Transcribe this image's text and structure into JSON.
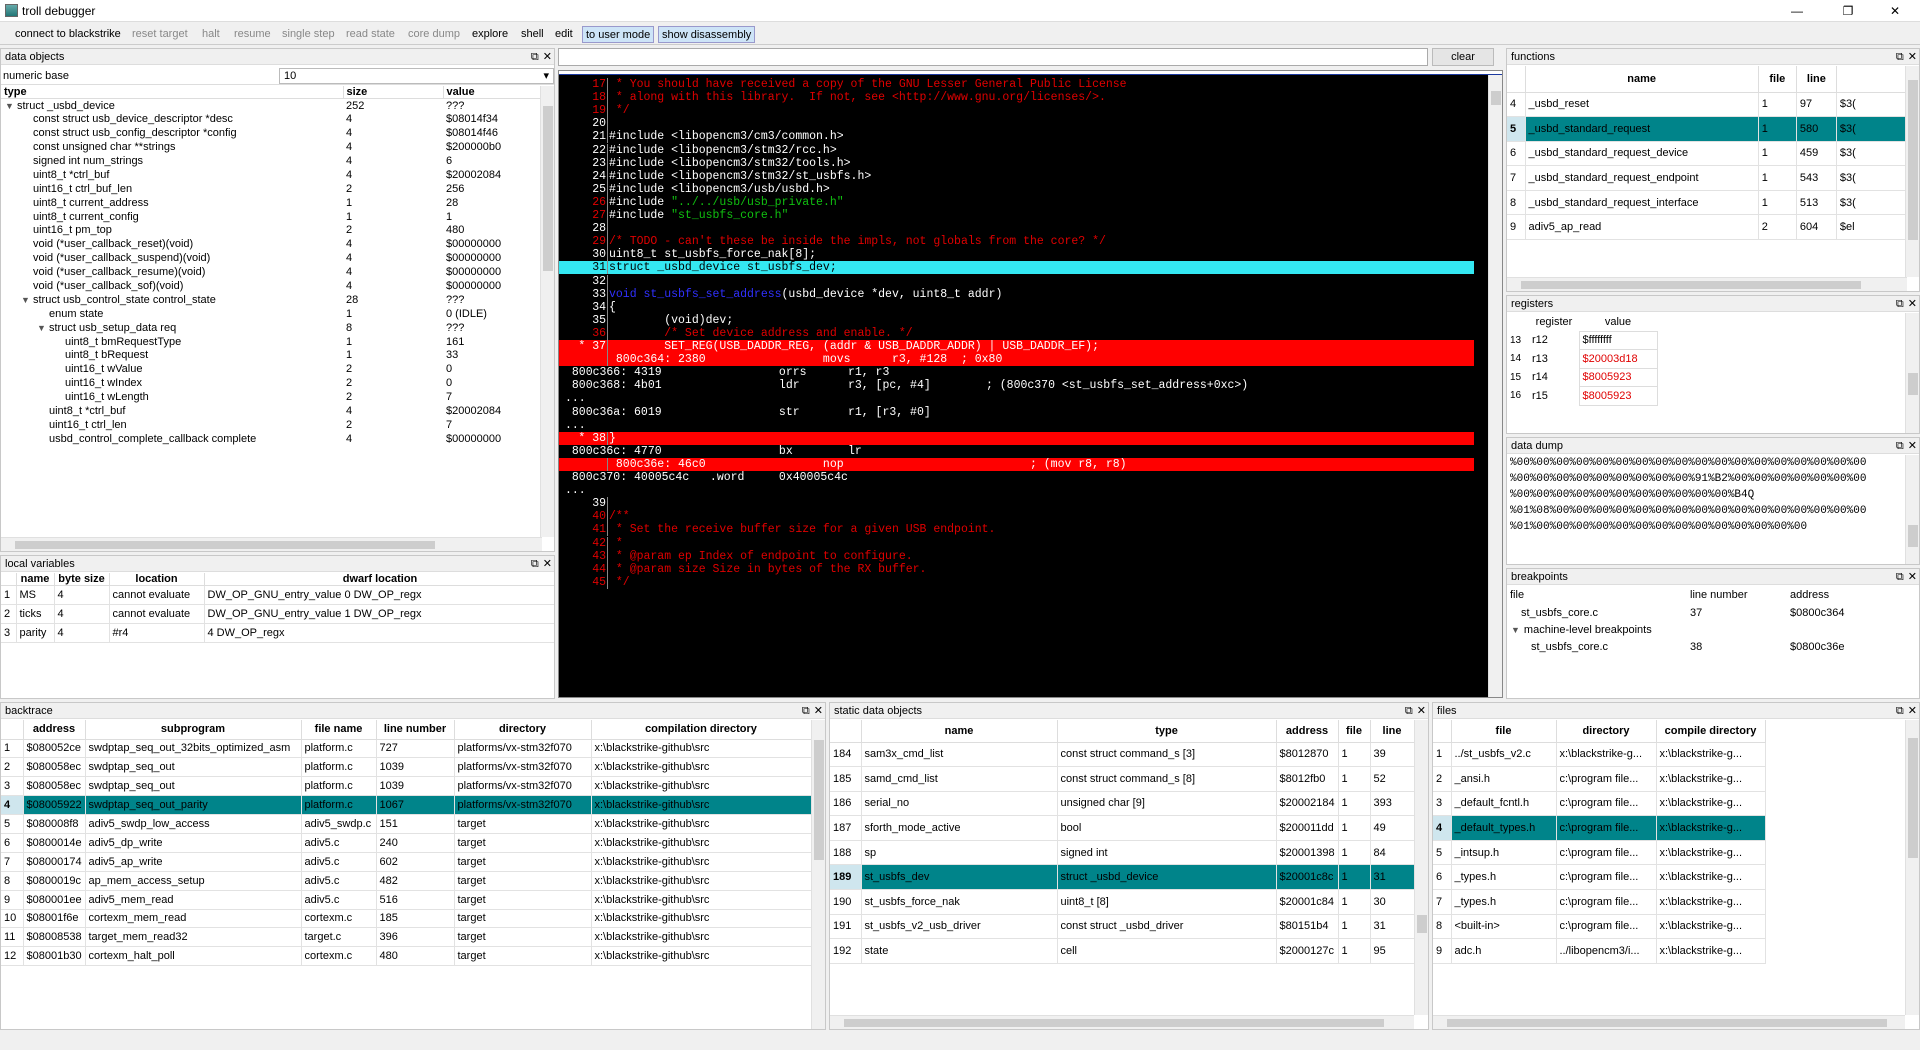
{
  "window": {
    "title": "troll debugger",
    "min": "—",
    "max": "❐",
    "close": "✕"
  },
  "toolbar": [
    "connect to blackstrike",
    "reset target",
    "halt",
    "resume",
    "single step",
    "read state",
    "core dump",
    "explore",
    "shell",
    "edit",
    "to user mode",
    "show disassembly"
  ],
  "data_objects": {
    "title": "data objects",
    "numeric_base_label": "numeric base",
    "numeric_base": "10",
    "cols": [
      "type",
      "size",
      "value"
    ],
    "rows": [
      {
        "i": 0,
        "e": "▼",
        "t": "struct _usbd_device",
        "s": "252",
        "v": "???"
      },
      {
        "i": 1,
        "t": "const struct usb_device_descriptor *desc",
        "s": "4",
        "v": "$08014f34"
      },
      {
        "i": 1,
        "t": "const struct usb_config_descriptor *config",
        "s": "4",
        "v": "$08014f46"
      },
      {
        "i": 1,
        "t": "const unsigned char **strings",
        "s": "4",
        "v": "$200000b0"
      },
      {
        "i": 1,
        "t": "signed int num_strings",
        "s": "4",
        "v": "6"
      },
      {
        "i": 1,
        "t": "uint8_t *ctrl_buf",
        "s": "4",
        "v": "$20002084"
      },
      {
        "i": 1,
        "t": "uint16_t ctrl_buf_len",
        "s": "2",
        "v": "256"
      },
      {
        "i": 1,
        "t": "uint8_t current_address",
        "s": "1",
        "v": "28"
      },
      {
        "i": 1,
        "t": "uint8_t current_config",
        "s": "1",
        "v": "1"
      },
      {
        "i": 1,
        "t": "uint16_t pm_top",
        "s": "2",
        "v": "480"
      },
      {
        "i": 1,
        "t": "void (*user_callback_reset)(void)",
        "s": "4",
        "v": "$00000000"
      },
      {
        "i": 1,
        "t": "void (*user_callback_suspend)(void)",
        "s": "4",
        "v": "$00000000"
      },
      {
        "i": 1,
        "t": "void (*user_callback_resume)(void)",
        "s": "4",
        "v": "$00000000"
      },
      {
        "i": 1,
        "t": "void (*user_callback_sof)(void)",
        "s": "4",
        "v": "$00000000"
      },
      {
        "i": 1,
        "e": "▼",
        "t": "struct usb_control_state control_state",
        "s": "28",
        "v": "???"
      },
      {
        "i": 2,
        "t": "enum  state",
        "s": "1",
        "v": "0 (IDLE)"
      },
      {
        "i": 2,
        "e": "▼",
        "t": "struct usb_setup_data req",
        "s": "8",
        "v": "???"
      },
      {
        "i": 3,
        "t": "uint8_t bmRequestType",
        "s": "1",
        "v": "161"
      },
      {
        "i": 3,
        "t": "uint8_t bRequest",
        "s": "1",
        "v": "33"
      },
      {
        "i": 3,
        "t": "uint16_t wValue",
        "s": "2",
        "v": "0"
      },
      {
        "i": 3,
        "t": "uint16_t wIndex",
        "s": "2",
        "v": "0"
      },
      {
        "i": 3,
        "t": "uint16_t wLength",
        "s": "2",
        "v": "7"
      },
      {
        "i": 2,
        "t": "uint8_t *ctrl_buf",
        "s": "4",
        "v": "$20002084"
      },
      {
        "i": 2,
        "t": "uint16_t ctrl_len",
        "s": "2",
        "v": "7"
      },
      {
        "i": 2,
        "t": "usbd_control_complete_callback complete",
        "s": "4",
        "v": "$00000000"
      }
    ]
  },
  "local_vars": {
    "title": "local variables",
    "cols": [
      "name",
      "byte size",
      "location",
      "dwarf location"
    ],
    "rows": [
      [
        "1",
        "MS",
        "4",
        "cannot evaluate",
        "DW_OP_GNU_entry_value 0 DW_OP_regx",
        "DW_OP_GNU_entry_value"
      ],
      [
        "2",
        "ticks",
        "4",
        "cannot evaluate",
        "DW_OP_GNU_entry_value 1 DW_OP_regx",
        "DW_OP_GNU_entry_value"
      ],
      [
        "3",
        "parity",
        "4",
        "#r4",
        "4 DW_OP_regx",
        ""
      ]
    ]
  },
  "search": {
    "value": "",
    "clear": "clear"
  },
  "source": [
    {
      "n": "17",
      "t": " * You should have received a copy of the GNU Lesser General Public License",
      "c": "red"
    },
    {
      "n": "18",
      "t": " * along with this library.  If not, see <http://www.gnu.org/licenses/>.",
      "c": "red"
    },
    {
      "n": "19",
      "t": " */",
      "c": "red"
    },
    {
      "n": "20",
      "t": "",
      "c": ""
    },
    {
      "n": "21",
      "t": "#include <libopencm3/cm3/common.h>",
      "c": ""
    },
    {
      "n": "22",
      "t": "#include <libopencm3/stm32/rcc.h>",
      "c": ""
    },
    {
      "n": "23",
      "t": "#include <libopencm3/stm32/tools.h>",
      "c": ""
    },
    {
      "n": "24",
      "t": "#include <libopencm3/stm32/st_usbfs.h>",
      "c": ""
    },
    {
      "n": "25",
      "t": "#include <libopencm3/usb/usbd.h>",
      "c": ""
    },
    {
      "n": "26",
      "t": "#include \"../../usb/usb_private.h\"",
      "c": "grn"
    },
    {
      "n": "27",
      "t": "#include \"st_usbfs_core.h\"",
      "c": "grn"
    },
    {
      "n": "28",
      "t": "",
      "c": ""
    },
    {
      "n": "29",
      "t": "/* TODO - can't these be inside the impls, not globals from the core? */",
      "c": "red"
    },
    {
      "n": "30",
      "t": "uint8_t st_usbfs_force_nak[8];",
      "c": ""
    },
    {
      "n": "31",
      "t": "struct _usbd_device st_usbfs_dev;",
      "c": "cur"
    },
    {
      "n": "32",
      "t": "",
      "c": ""
    },
    {
      "n": "33",
      "t": "void st_usbfs_set_address(usbd_device *dev, uint8_t addr)",
      "c": "fn"
    },
    {
      "n": "34",
      "t": "{",
      "c": ""
    },
    {
      "n": "35",
      "t": "        (void)dev;",
      "c": ""
    },
    {
      "n": "36",
      "t": "        /* Set device address and enable. */",
      "c": "red"
    },
    {
      "n": "* 37",
      "t": "        SET_REG(USB_DADDR_REG, (addr & USB_DADDR_ADDR) | USB_DADDR_EF);",
      "c": "brk"
    },
    {
      "n": "",
      "t": " 800c364: 2380                 movs      r3, #128  ; 0x80",
      "c": "brk"
    },
    {
      "n": "",
      "t": " 800c366: 4319                 orrs      r1, r3",
      "c": "asm"
    },
    {
      "n": "",
      "t": " 800c368: 4b01                 ldr       r3, [pc, #4]        ; (800c370 <st_usbfs_set_address+0xc>)",
      "c": "asm"
    },
    {
      "n": "",
      "t": "...",
      "c": "asm"
    },
    {
      "n": "",
      "t": " 800c36a: 6019                 str       r1, [r3, #0]",
      "c": "asm"
    },
    {
      "n": "",
      "t": "...",
      "c": "asm"
    },
    {
      "n": "* 38",
      "t": "}",
      "c": "brk"
    },
    {
      "n": "",
      "t": " 800c36c: 4770                 bx        lr",
      "c": "asm"
    },
    {
      "n": "",
      "t": " 800c36e: 46c0                 nop                           ; (mov r8, r8)",
      "c": "brk"
    },
    {
      "n": "",
      "t": " 800c370: 40005c4c   .word     0x40005c4c",
      "c": "asm"
    },
    {
      "n": "",
      "t": "...",
      "c": "asm"
    },
    {
      "n": "39",
      "t": "",
      "c": ""
    },
    {
      "n": "40",
      "t": "/**",
      "c": "red"
    },
    {
      "n": "41",
      "t": " * Set the receive buffer size for a given USB endpoint.",
      "c": "red"
    },
    {
      "n": "42",
      "t": " *",
      "c": "red"
    },
    {
      "n": "43",
      "t": " * @param ep Index of endpoint to configure.",
      "c": "red"
    },
    {
      "n": "44",
      "t": " * @param size Size in bytes of the RX buffer.",
      "c": "red"
    },
    {
      "n": "45",
      "t": " */",
      "c": "red"
    }
  ],
  "functions": {
    "title": "functions",
    "cols": [
      "name",
      "file",
      "line"
    ],
    "rows": [
      [
        "4",
        "_usbd_reset",
        "1",
        "97",
        "$3("
      ],
      [
        "5",
        "_usbd_standard_request",
        "1",
        "580",
        "$3("
      ],
      [
        "6",
        "_usbd_standard_request_device",
        "1",
        "459",
        "$3("
      ],
      [
        "7",
        "_usbd_standard_request_endpoint",
        "1",
        "543",
        "$3("
      ],
      [
        "8",
        "_usbd_standard_request_interface",
        "1",
        "513",
        "$3("
      ],
      [
        "9",
        "adiv5_ap_read",
        "2",
        "604",
        "$el"
      ]
    ],
    "sel": 1
  },
  "registers": {
    "title": "registers",
    "cols": [
      "register",
      "value"
    ],
    "rows": [
      [
        "13",
        "r12",
        "$ffffffff",
        false
      ],
      [
        "14",
        "r13",
        "$20003d18",
        true
      ],
      [
        "15",
        "r14",
        "$8005923",
        true
      ],
      [
        "16",
        "r15",
        "$8005923",
        true
      ]
    ]
  },
  "data_dump": {
    "title": "data dump",
    "lines": [
      "%00%00%00%00%00%00%00%00%00%00%00%00%00%00%00%00%00%00",
      "%00%00%00%00%00%00%00%00%00%91%B2%00%00%00%00%00%00%00",
      "%00%00%00%00%00%00%00%00%00%00%00%B4Q",
      "%01%08%00%00%00%00%00%00%00%00%00%00%00%00%00%00%00%00",
      "%01%00%00%00%00%00%00%00%00%00%00%00%00%00%00"
    ]
  },
  "breakpoints": {
    "title": "breakpoints",
    "cols": [
      "file",
      "line number",
      "address"
    ],
    "rows": [
      {
        "i": 1,
        "f": "st_usbfs_core.c",
        "l": "37",
        "a": "$0800c364"
      },
      {
        "i": 0,
        "e": "▼",
        "f": "machine-level breakpoints",
        "l": "",
        "a": ""
      },
      {
        "i": 2,
        "f": "st_usbfs_core.c",
        "l": "38",
        "a": "$0800c36e"
      }
    ]
  },
  "backtrace": {
    "title": "backtrace",
    "cols": [
      "address",
      "subprogram",
      "file name",
      "line number",
      "directory",
      "compilation directory"
    ],
    "rows": [
      [
        "1",
        "$080052ce",
        "swdptap_seq_out_32bits_optimized_asm",
        "platform.c",
        "727",
        "platforms/vx-stm32f070",
        "x:\\blackstrike-github\\src"
      ],
      [
        "2",
        "$080058ec",
        "swdptap_seq_out",
        "platform.c",
        "1039",
        "platforms/vx-stm32f070",
        "x:\\blackstrike-github\\src"
      ],
      [
        "3",
        "$080058ec",
        "swdptap_seq_out",
        "platform.c",
        "1039",
        "platforms/vx-stm32f070",
        "x:\\blackstrike-github\\src"
      ],
      [
        "4",
        "$08005922",
        "swdptap_seq_out_parity",
        "platform.c",
        "1067",
        "platforms/vx-stm32f070",
        "x:\\blackstrike-github\\src"
      ],
      [
        "5",
        "$080008f8",
        "adiv5_swdp_low_access",
        "adiv5_swdp.c",
        "151",
        "target",
        "x:\\blackstrike-github\\src"
      ],
      [
        "6",
        "$0800014e",
        "adiv5_dp_write",
        "adiv5.c",
        "240",
        "target",
        "x:\\blackstrike-github\\src"
      ],
      [
        "7",
        "$08000174",
        "adiv5_ap_write",
        "adiv5.c",
        "602",
        "target",
        "x:\\blackstrike-github\\src"
      ],
      [
        "8",
        "$0800019c",
        "ap_mem_access_setup",
        "adiv5.c",
        "482",
        "target",
        "x:\\blackstrike-github\\src"
      ],
      [
        "9",
        "$080001ee",
        "adiv5_mem_read",
        "adiv5.c",
        "516",
        "target",
        "x:\\blackstrike-github\\src"
      ],
      [
        "10",
        "$08001f6e",
        "cortexm_mem_read",
        "cortexm.c",
        "185",
        "target",
        "x:\\blackstrike-github\\src"
      ],
      [
        "11",
        "$08008538",
        "target_mem_read32",
        "target.c",
        "396",
        "target",
        "x:\\blackstrike-github\\src"
      ],
      [
        "12",
        "$08001b30",
        "cortexm_halt_poll",
        "cortexm.c",
        "480",
        "target",
        "x:\\blackstrike-github\\src"
      ]
    ],
    "sel": 3
  },
  "static_objs": {
    "title": "static data objects",
    "cols": [
      "name",
      "type",
      "address",
      "file",
      "line"
    ],
    "rows": [
      [
        "184",
        "sam3x_cmd_list",
        "const struct command_s [3]",
        "$8012870",
        "1",
        "39"
      ],
      [
        "185",
        "samd_cmd_list",
        "const struct command_s [8]",
        "$8012fb0",
        "1",
        "52"
      ],
      [
        "186",
        "serial_no",
        "unsigned char [9]",
        "$20002184",
        "1",
        "393"
      ],
      [
        "187",
        "sforth_mode_active",
        "bool",
        "$200011dd",
        "1",
        "49"
      ],
      [
        "188",
        "sp",
        "signed int",
        "$20001398",
        "1",
        "84"
      ],
      [
        "189",
        "st_usbfs_dev",
        "struct _usbd_device",
        "$20001c8c",
        "1",
        "31"
      ],
      [
        "190",
        "st_usbfs_force_nak",
        "uint8_t [8]",
        "$20001c84",
        "1",
        "30"
      ],
      [
        "191",
        "st_usbfs_v2_usb_driver",
        "const struct _usbd_driver",
        "$80151b4",
        "1",
        "31"
      ],
      [
        "192",
        "state",
        "cell",
        "$2000127c",
        "1",
        "95"
      ]
    ],
    "sel": 5
  },
  "files": {
    "title": "files",
    "cols": [
      "file",
      "directory",
      "compile directory"
    ],
    "rows": [
      [
        "1",
        "../st_usbfs_v2.c",
        "x:\\blackstrike-g...",
        "x:\\blackstrike-g..."
      ],
      [
        "2",
        "_ansi.h",
        "c:\\program file...",
        "x:\\blackstrike-g..."
      ],
      [
        "3",
        "_default_fcntl.h",
        "c:\\program file...",
        "x:\\blackstrike-g..."
      ],
      [
        "4",
        "_default_types.h",
        "c:\\program file...",
        "x:\\blackstrike-g..."
      ],
      [
        "5",
        "_intsup.h",
        "c:\\program file...",
        "x:\\blackstrike-g..."
      ],
      [
        "6",
        "_types.h",
        "c:\\program file...",
        "x:\\blackstrike-g..."
      ],
      [
        "7",
        "_types.h",
        "c:\\program file...",
        "x:\\blackstrike-g..."
      ],
      [
        "8",
        "<built-in>",
        "c:\\program file...",
        "x:\\blackstrike-g..."
      ],
      [
        "9",
        "adc.h",
        "../libopencm3/i...",
        "x:\\blackstrike-g..."
      ]
    ],
    "sel": 3
  },
  "colors": {
    "selection": "#00848a",
    "breakpoint": "#ff0000",
    "current_line": "#34e8f2",
    "comment": "#e00000",
    "string": "#10c010"
  }
}
